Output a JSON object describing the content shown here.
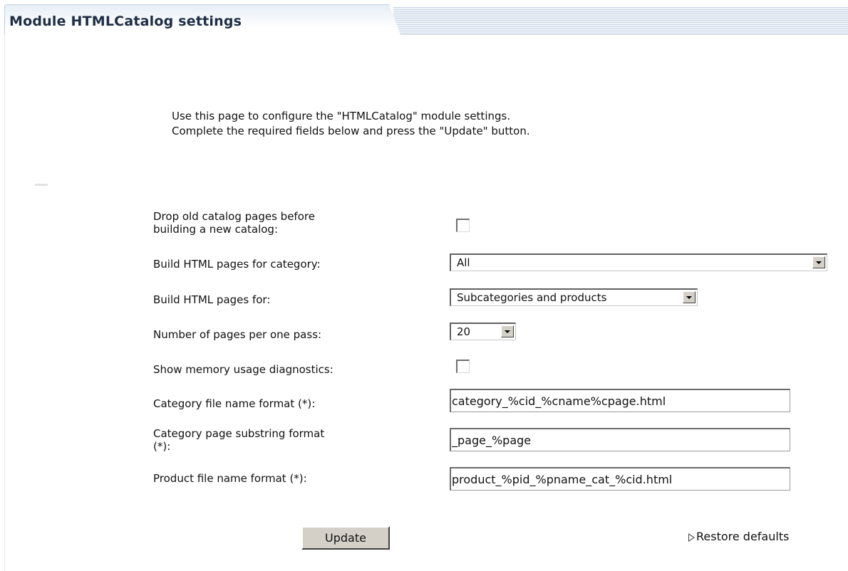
{
  "header": {
    "title": "Module HTMLCatalog settings"
  },
  "intro": {
    "line1": "Use this page to configure the \"HTMLCatalog\" module settings.",
    "line2": "Complete the required fields below and press the \"Update\" button."
  },
  "form": {
    "drop_old": {
      "label_line1": "Drop old catalog pages before",
      "label_line2": "building a new catalog:",
      "checked": false
    },
    "build_category": {
      "label": "Build HTML pages for category:",
      "selected": "All"
    },
    "build_for": {
      "label": "Build HTML pages for:",
      "selected": "Subcategories and products"
    },
    "pages_per_pass": {
      "label": "Number of pages per one pass:",
      "selected": "20"
    },
    "memory_diag": {
      "label": "Show memory usage diagnostics:",
      "checked": false
    },
    "category_file_format": {
      "label": "Category file name format (*):",
      "value": "category_%cid_%cname%cpage.html"
    },
    "category_page_substring": {
      "label_line1": "Category page substring format",
      "label_line2": "(*):",
      "value": "_page_%page"
    },
    "product_file_format": {
      "label": "Product file name format (*):",
      "value": "product_%pid_%pname_cat_%cid.html"
    }
  },
  "actions": {
    "update_label": "Update",
    "restore_label": "Restore defaults",
    "restore_icon": "triangle-right-outline-icon"
  }
}
